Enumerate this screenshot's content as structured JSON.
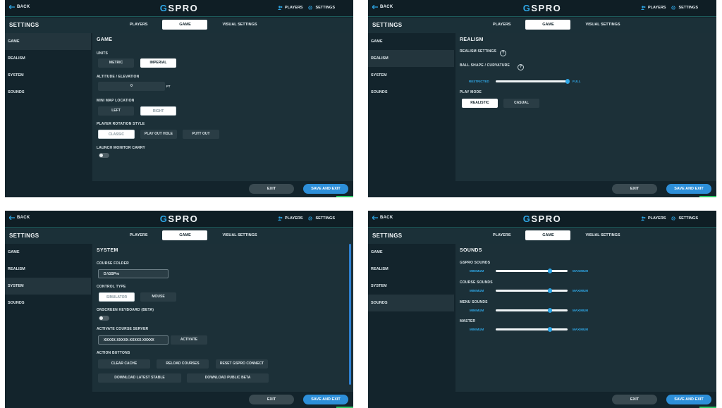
{
  "app": {
    "logo": "GSPRO",
    "back_label": "BACK",
    "players_label": "PLAYERS",
    "settings_label": "SETTINGS",
    "page_title": "SETTINGS",
    "tabs": [
      "PLAYERS",
      "GAME",
      "VISUAL SETTINGS"
    ],
    "active_tab": "GAME",
    "sidebar": [
      "GAME",
      "REALISM",
      "SYSTEM",
      "SOUNDS"
    ],
    "exit_label": "EXIT",
    "save_label": "SAVE AND EXIT",
    "accent_color": "#2d8fd9",
    "bg_color": "#13242c"
  },
  "game": {
    "title": "GAME",
    "units_label": "UNITS",
    "units_options": [
      "METRIC",
      "IMPERIAL"
    ],
    "units_selected": "IMPERIAL",
    "altitude_label": "ALTITUDE / ELEVATION",
    "altitude_value": "0",
    "altitude_unit": "FT",
    "minimap_label": "MINI MAP LOCATION",
    "minimap_options": [
      "LEFT",
      "RIGHT"
    ],
    "minimap_selected": "RIGHT",
    "rotation_label": "PLAYER ROTATION STYLE",
    "rotation_options": [
      "CLASSIC",
      "PLAY OUT HOLE",
      "PUTT OUT"
    ],
    "rotation_selected": "CLASSIC",
    "carry_label": "LAUNCH MONITOR CARRY",
    "carry_on": false
  },
  "realism": {
    "title": "REALISM",
    "settings_label": "REALISM SETTINGS",
    "ball_label": "BALL SHAPE / CURVATURE",
    "slider_min": "RESTRICTED",
    "slider_max": "FULL",
    "slider_value": 1.0,
    "playmode_label": "PLAY MODE",
    "playmode_options": [
      "REALISTIC",
      "CASUAL"
    ],
    "playmode_selected": "REALISTIC"
  },
  "system": {
    "title": "SYSTEM",
    "folder_label": "COURSE FOLDER",
    "folder_value": "D:\\GSPro",
    "control_label": "CONTROL TYPE",
    "control_options": [
      "SIMULATOR",
      "MOUSE"
    ],
    "control_selected": "SIMULATOR",
    "keyboard_label": "ONSCREEN KEYBOARD (BETA)",
    "keyboard_on": false,
    "server_label": "ACTIVATE COURSE SERVER",
    "server_value": "XXXXX-XXXXX-XXXXX-XXXXX",
    "activate_label": "ACTIVATE",
    "actions_label": "ACTION BUTTONS",
    "actions": [
      "CLEAR CACHE",
      "RELOAD COURSES",
      "RESET GSPRO CONNECT",
      "DOWNLOAD LATEST STABLE",
      "DOWNLOAD PUBLIC BETA"
    ]
  },
  "sounds": {
    "title": "SOUNDS",
    "min_label": "MINIMUM",
    "max_label": "MAXIMUM",
    "items": [
      {
        "label": "GSPRO SOUNDS",
        "value": 0.75
      },
      {
        "label": "COURSE SOUNDS",
        "value": 0.75
      },
      {
        "label": "MENU SOUNDS",
        "value": 0.75
      },
      {
        "label": "MASTER",
        "value": 0.75
      }
    ]
  }
}
